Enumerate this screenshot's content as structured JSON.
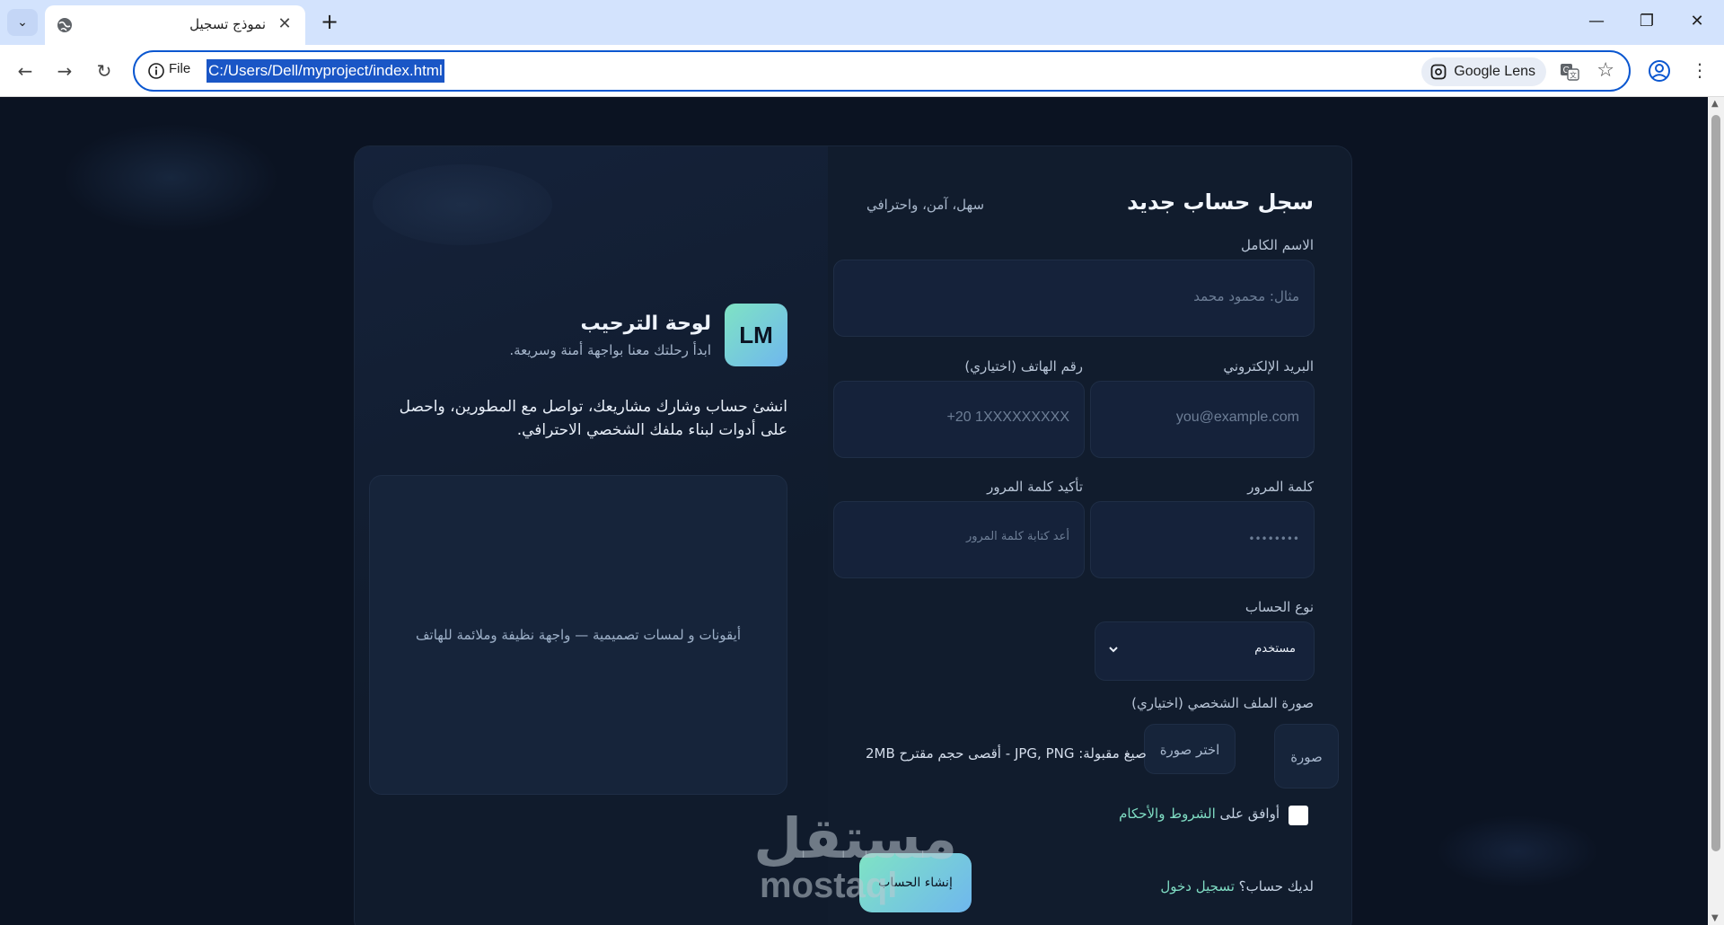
{
  "browser": {
    "tab_title": "نموذج تسجيل",
    "new_tab": "+",
    "close_tab": "✕",
    "address_scheme": "File",
    "address_url": "C:/Users/Dell/myproject/index.html",
    "lens_label": "Google Lens",
    "window_controls": {
      "minimize": "—",
      "restore": "❐",
      "close": "✕"
    }
  },
  "welcome_panel": {
    "logo_text": "LM",
    "title": "لوحة الترحيب",
    "subtitle": "ابدأ رحلتك معنا بواجهة أمنة وسريعة.",
    "intro": "انشئ حساب وشارك مشاريعك، تواصل مع المطورين، واحصل على أدوات لبناء ملفك الشخصي الاحترافي.",
    "showcase_caption": "أيقونات و لمسات تصميمية — واجهة نظيفة وملائمة للهاتف"
  },
  "form": {
    "title": "سجل حساب جديد",
    "subtitle": "سهل، آمن، واحترافي",
    "full_name": {
      "label": "الاسم الكامل",
      "placeholder": "مثال: محمود محمد"
    },
    "email": {
      "label": "البريد الإلكتروني",
      "placeholder": "you@example.com"
    },
    "phone": {
      "label": "رقم الهاتف (اختياري)",
      "placeholder": "+20 1XXXXXXXXX"
    },
    "password": {
      "label": "كلمة المرور",
      "placeholder": "••••••••"
    },
    "confirm_password": {
      "label": "تأكيد كلمة المرور",
      "placeholder": "أعد كتابة كلمة المرور"
    },
    "account_type": {
      "label": "نوع الحساب",
      "selected": "مستخدم"
    },
    "avatar": {
      "label": "صورة الملف الشخصي (اختياري)",
      "preview": "صورة",
      "choose_button": "اختر صورة",
      "hint": "صيغ مقبولة: JPG, PNG - أقصى حجم مقترح 2MB"
    },
    "terms": {
      "prefix": "أوافق على",
      "link": "الشروط والأحكام",
      "checked": false
    },
    "submit_label": "إنشاء الحساب",
    "login": {
      "prompt": "لديك حساب؟",
      "link": "تسجيل دخول"
    }
  },
  "watermark": {
    "arabic": "مستقل",
    "latin": "mostaql"
  },
  "colors": {
    "accent_start": "#7fe3c4",
    "accent_end": "#6fb7ee",
    "page_bg": "#0b1322",
    "card_bg": "#111c2d",
    "link": "#7fdcc3"
  }
}
